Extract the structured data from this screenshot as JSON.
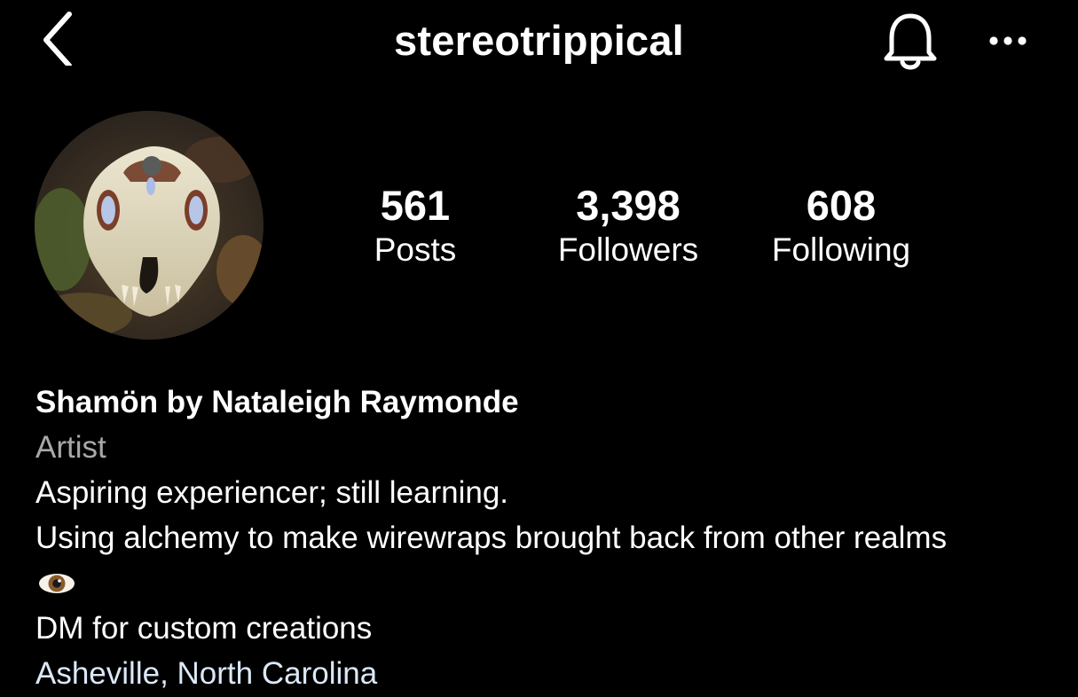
{
  "header": {
    "username": "stereotrippical",
    "back_icon": "chevron-left-icon",
    "notification_icon": "bell-icon",
    "more_icon": "more-horizontal-icon"
  },
  "profile": {
    "avatar_description_icon": "avatar",
    "stats": [
      {
        "value": "561",
        "label": "Posts"
      },
      {
        "value": "3,398",
        "label": "Followers"
      },
      {
        "value": "608",
        "label": "Following"
      }
    ],
    "name": "Shamön by Nataleigh Raymonde",
    "category": "Artist",
    "bio_lines": [
      "Aspiring experiencer; still learning.",
      "Using alchemy to make wirewraps brought back from other realms",
      "DM for custom creations"
    ],
    "bio_emoji": "eye-icon",
    "location": "Asheville, North Carolina"
  },
  "colors": {
    "background": "#000000",
    "text": "#ffffff",
    "secondary_text": "#a8a8a8",
    "link_text": "#dbe8f8"
  }
}
